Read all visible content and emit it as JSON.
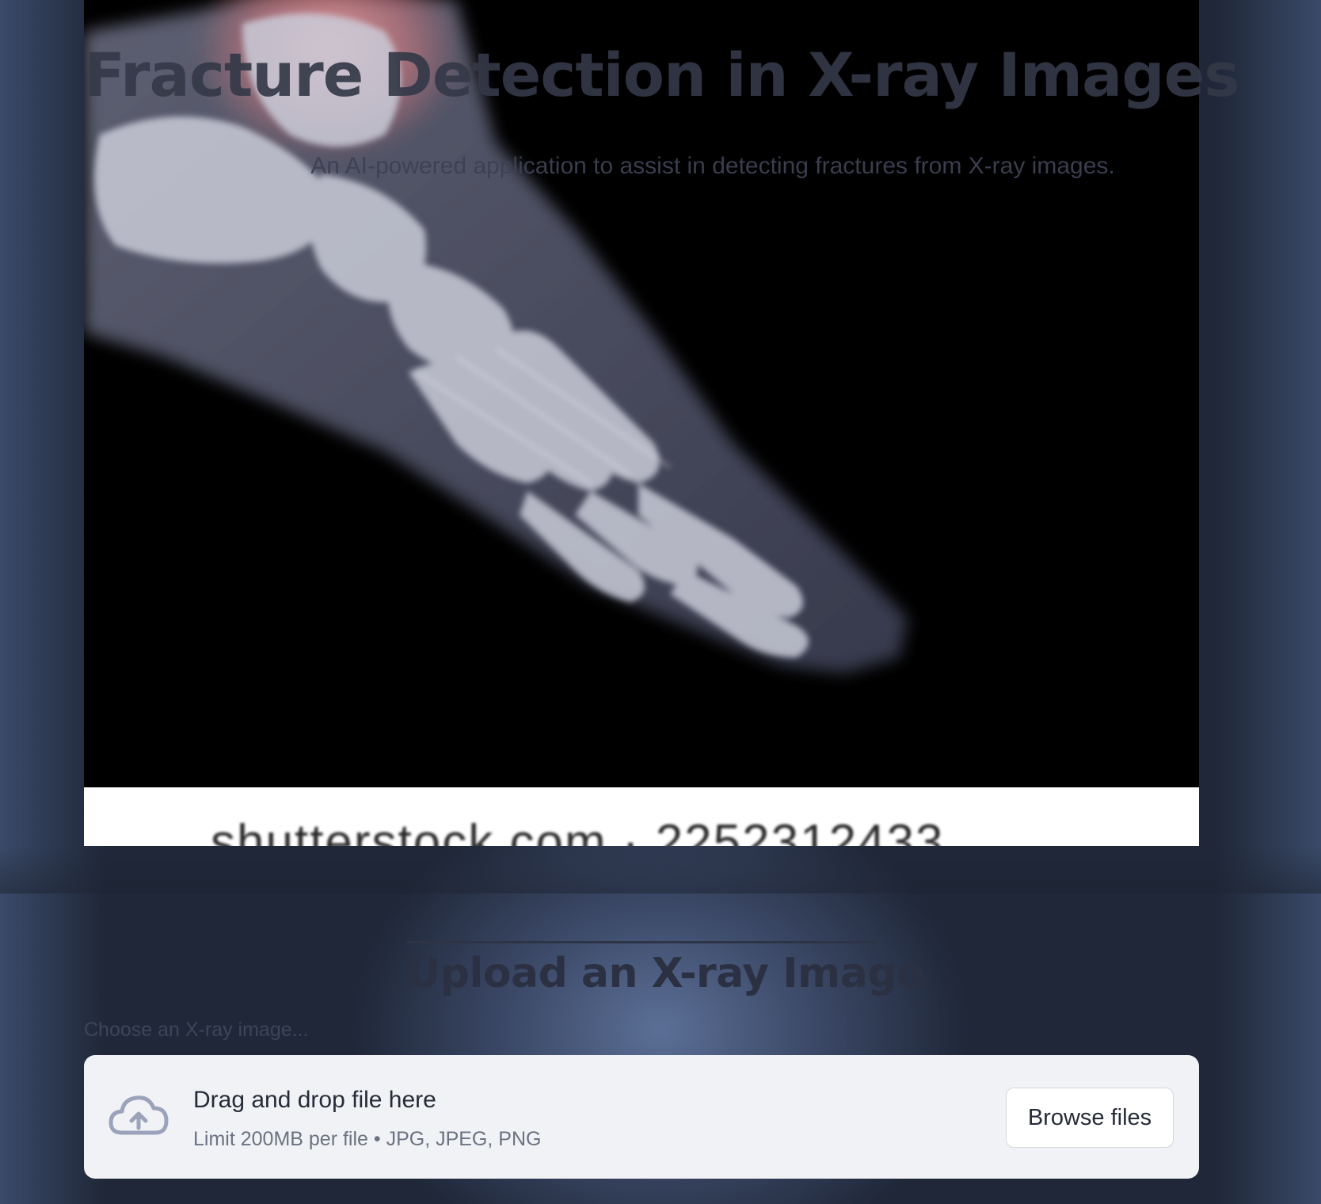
{
  "header": {
    "title": "Fracture Detection in X-ray Images",
    "subtitle": "An AI-powered application to assist in detecting fractures from X-ray images."
  },
  "hero_image": {
    "watermark_text": "shutterstock.com · 2252312433"
  },
  "upload": {
    "heading": "Upload an X-ray Image",
    "label": "Choose an X-ray image...",
    "dropzone_title": "Drag and drop file here",
    "dropzone_limit": "Limit 200MB per file • JPG, JPEG, PNG",
    "browse_label": "Browse files",
    "icon": "cloud-upload-icon"
  },
  "colors": {
    "page_bg": "#1e2534",
    "dropzone_bg": "#f0f2f6",
    "icon_color": "#9aa3ba"
  }
}
